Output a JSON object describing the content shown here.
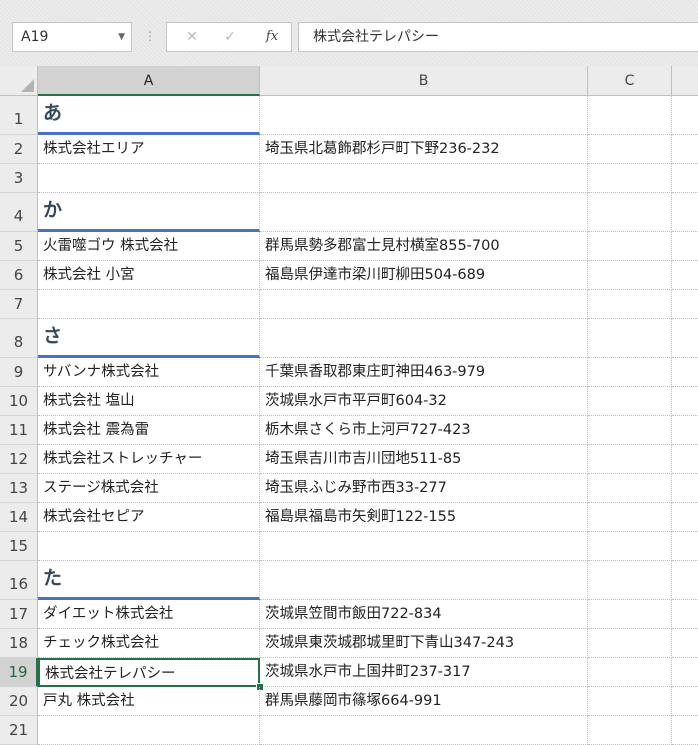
{
  "formula_bar": {
    "name_box": "A19",
    "cancel_icon": "✕",
    "enter_icon": "✓",
    "fx_label": "fx",
    "formula": "株式会社テレパシー"
  },
  "columns": [
    "A",
    "B",
    "C"
  ],
  "selected_column": "A",
  "rows": [
    {
      "n": "1",
      "a": "あ",
      "b": "",
      "kind": "heading"
    },
    {
      "n": "2",
      "a": "株式会社エリア",
      "b": "埼玉県北葛飾郡杉戸町下野236-232"
    },
    {
      "n": "3",
      "a": "",
      "b": ""
    },
    {
      "n": "4",
      "a": "か",
      "b": "",
      "kind": "heading"
    },
    {
      "n": "5",
      "a": "火雷噬ゴウ 株式会社",
      "b": "群馬県勢多郡富士見村横室855-700"
    },
    {
      "n": "6",
      "a": "株式会社 小宮",
      "b": "福島県伊達市梁川町柳田504-689"
    },
    {
      "n": "7",
      "a": "",
      "b": ""
    },
    {
      "n": "8",
      "a": "さ",
      "b": "",
      "kind": "heading"
    },
    {
      "n": "9",
      "a": "サバンナ株式会社",
      "b": "千葉県香取郡東庄町神田463-979"
    },
    {
      "n": "10",
      "a": "株式会社 塩山",
      "b": "茨城県水戸市平戸町604-32"
    },
    {
      "n": "11",
      "a": "株式会社 震為雷",
      "b": "栃木県さくら市上河戸727-423"
    },
    {
      "n": "12",
      "a": "株式会社ストレッチャー",
      "b": "埼玉県吉川市吉川団地511-85"
    },
    {
      "n": "13",
      "a": "ステージ株式会社",
      "b": "埼玉県ふじみ野市西33-277"
    },
    {
      "n": "14",
      "a": "株式会社セピア",
      "b": "福島県福島市矢剣町122-155"
    },
    {
      "n": "15",
      "a": "",
      "b": ""
    },
    {
      "n": "16",
      "a": "た",
      "b": "",
      "kind": "heading"
    },
    {
      "n": "17",
      "a": "ダイエット株式会社",
      "b": "茨城県笠間市飯田722-834"
    },
    {
      "n": "18",
      "a": "チェック株式会社",
      "b": "茨城県東茨城郡城里町下青山347-243"
    },
    {
      "n": "19",
      "a": "株式会社テレパシー",
      "b": "茨城県水戸市上国井町237-317",
      "active": true
    },
    {
      "n": "20",
      "a": "戸丸 株式会社",
      "b": "群馬県藤岡市篠塚664-991"
    },
    {
      "n": "21",
      "a": "",
      "b": ""
    }
  ],
  "colors": {
    "accent_green": "#217346",
    "heading_rule": "#4472c4"
  }
}
